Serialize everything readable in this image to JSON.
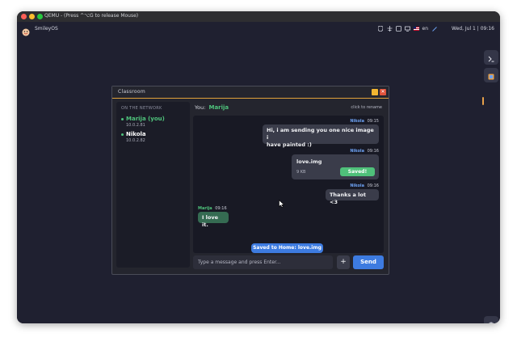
{
  "host_window": {
    "title": "QEMU - (Press ^⌥G to release Mouse)"
  },
  "os": {
    "name": "SmileyOS",
    "tray": {
      "language": "en",
      "datetime": "Wed, Jul 1 | 09:16"
    },
    "dock": {
      "items": [
        "terminal-icon",
        "app-icon"
      ],
      "trash": "trash-icon"
    }
  },
  "app": {
    "title": "Classroom",
    "sidebar": {
      "heading": "ON THE NETWORK",
      "peers": [
        {
          "name": "Marija (you)",
          "ip": "10.0.2.81",
          "color": "#4ec27b"
        },
        {
          "name": "Nikola",
          "ip": "10.0.2.82",
          "color": "#ffffff"
        }
      ]
    },
    "header": {
      "you_label": "You:",
      "you_name": "Marija",
      "rename_hint": "click to rename"
    },
    "messages": [
      {
        "sender": "Nikola",
        "time": "09:15",
        "line1": "Hi, i am sending you one nice image i",
        "line2": "have painted :)"
      },
      {
        "sender": "Nikola",
        "time": "09:16",
        "file_name": "love.img",
        "file_size": "9 KB",
        "file_status": "Saved!"
      },
      {
        "sender": "Nikola",
        "time": "09:16",
        "text": "Thanks a lot <3"
      },
      {
        "sender": "Marija",
        "time": "09:16",
        "text": "I love it."
      }
    ],
    "toast": "Saved to Home: love.img",
    "composer": {
      "placeholder": "Type a message and press Enter...",
      "attach_label": "+",
      "send_label": "Send"
    },
    "colors": {
      "accent_blue": "#3d7be0",
      "accent_green": "#4ec27b",
      "title_accent": "#e0a13a"
    }
  }
}
